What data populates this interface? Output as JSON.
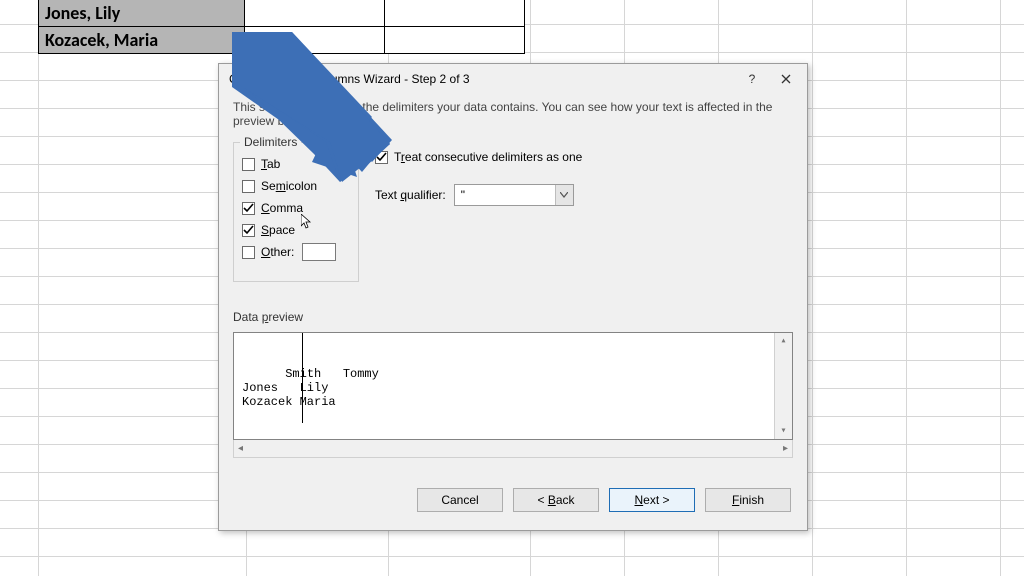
{
  "sheet": {
    "rows": [
      "Jones, Lily",
      "Kozacek, Maria"
    ]
  },
  "dialog": {
    "title": "Convert Text to Columns Wizard - Step 2 of 3",
    "help_glyph": "?",
    "intro": "This screen lets you set the delimiters your data contains.  You can see how your text is affected in the preview below.",
    "delimiters": {
      "legend": "Delimiters",
      "tab": "Tab",
      "semicolon": "Semicolon",
      "comma": "Comma",
      "space": "Space",
      "other": "Other:"
    },
    "treat": "Treat consecutive delimiters as one",
    "qualifier_label": "Text qualifier:",
    "qualifier_value": "\"",
    "preview_label": "Data preview",
    "preview_text": "Smith   Tommy\nJones   Lily\nKozacek Maria",
    "buttons": {
      "cancel": "Cancel",
      "back": "< Back",
      "next": "Next >",
      "finish": "Finish"
    }
  }
}
